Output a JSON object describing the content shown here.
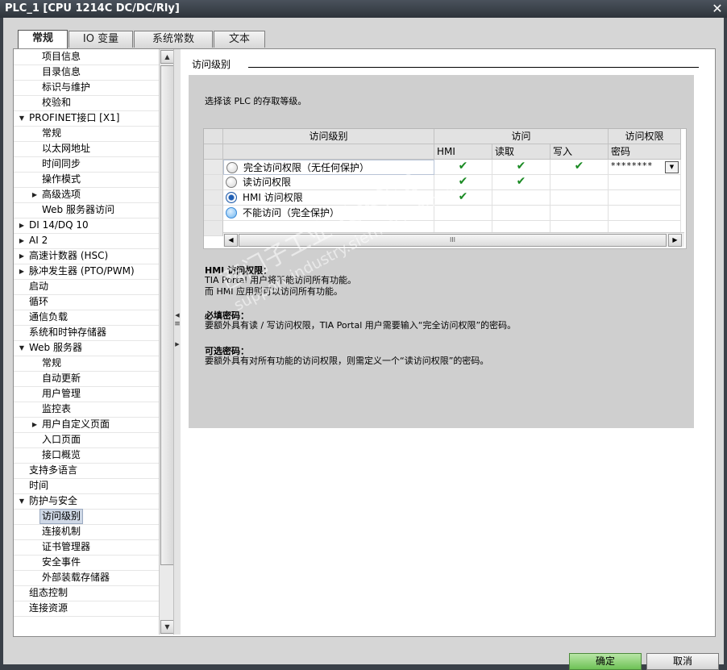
{
  "window": {
    "title": "PLC_1 [CPU 1214C DC/DC/Rly]",
    "close": "✕"
  },
  "tabs": [
    {
      "label": "常规",
      "active": true
    },
    {
      "label": "IO 变量",
      "active": false
    },
    {
      "label": "系统常数",
      "active": false
    },
    {
      "label": "文本",
      "active": false
    }
  ],
  "nav": [
    {
      "label": "项目信息",
      "level": 2,
      "arrow": ""
    },
    {
      "label": "目录信息",
      "level": 2,
      "arrow": ""
    },
    {
      "label": "标识与维护",
      "level": 2,
      "arrow": ""
    },
    {
      "label": "校验和",
      "level": 2,
      "arrow": ""
    },
    {
      "label": "PROFINET接口 [X1]",
      "level": 1,
      "arrow": "▼"
    },
    {
      "label": "常规",
      "level": 2,
      "arrow": ""
    },
    {
      "label": "以太网地址",
      "level": 2,
      "arrow": ""
    },
    {
      "label": "时间同步",
      "level": 2,
      "arrow": ""
    },
    {
      "label": "操作模式",
      "level": 2,
      "arrow": ""
    },
    {
      "label": "高级选项",
      "level": 2,
      "arrow": "▶"
    },
    {
      "label": "Web 服务器访问",
      "level": 2,
      "arrow": ""
    },
    {
      "label": "DI 14/DQ 10",
      "level": 1,
      "arrow": "▶"
    },
    {
      "label": "AI 2",
      "level": 1,
      "arrow": "▶"
    },
    {
      "label": "高速计数器 (HSC)",
      "level": 1,
      "arrow": "▶"
    },
    {
      "label": "脉冲发生器 (PTO/PWM)",
      "level": 1,
      "arrow": "▶"
    },
    {
      "label": "启动",
      "level": 1,
      "arrow": ""
    },
    {
      "label": "循环",
      "level": 1,
      "arrow": ""
    },
    {
      "label": "通信负载",
      "level": 1,
      "arrow": ""
    },
    {
      "label": "系统和时钟存储器",
      "level": 1,
      "arrow": ""
    },
    {
      "label": "Web 服务器",
      "level": 1,
      "arrow": "▼"
    },
    {
      "label": "常规",
      "level": 2,
      "arrow": ""
    },
    {
      "label": "自动更新",
      "level": 2,
      "arrow": ""
    },
    {
      "label": "用户管理",
      "level": 2,
      "arrow": ""
    },
    {
      "label": "监控表",
      "level": 2,
      "arrow": ""
    },
    {
      "label": "用户自定义页面",
      "level": 2,
      "arrow": "▶"
    },
    {
      "label": "入口页面",
      "level": 2,
      "arrow": ""
    },
    {
      "label": "接口概览",
      "level": 2,
      "arrow": ""
    },
    {
      "label": "支持多语言",
      "level": 1,
      "arrow": ""
    },
    {
      "label": "时间",
      "level": 1,
      "arrow": ""
    },
    {
      "label": "防护与安全",
      "level": 1,
      "arrow": "▼"
    },
    {
      "label": "访问级别",
      "level": 2,
      "arrow": "",
      "selected": true
    },
    {
      "label": "连接机制",
      "level": 2,
      "arrow": ""
    },
    {
      "label": "证书管理器",
      "level": 2,
      "arrow": ""
    },
    {
      "label": "安全事件",
      "level": 2,
      "arrow": ""
    },
    {
      "label": "外部装载存储器",
      "level": 2,
      "arrow": ""
    },
    {
      "label": "组态控制",
      "level": 1,
      "arrow": ""
    },
    {
      "label": "连接资源",
      "level": 1,
      "arrow": ""
    }
  ],
  "section": {
    "title": "访问级别",
    "intro": "选择该 PLC 的存取等级。"
  },
  "grid": {
    "header_level": "访问级别",
    "header_access": "访问",
    "header_perm": "访问权限",
    "col_hmi": "HMI",
    "col_read": "读取",
    "col_write": "写入",
    "col_pwd": "密码",
    "rows": [
      {
        "label": "完全访问权限（无任何保护）",
        "radio": "unchecked",
        "hmi": "✔",
        "read": "✔",
        "write": "✔",
        "pwd": "********",
        "dropdown": "▼"
      },
      {
        "label": "读访问权限",
        "radio": "unchecked",
        "hmi": "✔",
        "read": "✔",
        "write": "",
        "pwd": ""
      },
      {
        "label": "HMI 访问权限",
        "radio": "checked",
        "hmi": "✔",
        "read": "",
        "write": "",
        "pwd": ""
      },
      {
        "label": "不能访问（完全保护）",
        "radio": "blue",
        "hmi": "",
        "read": "",
        "write": "",
        "pwd": ""
      }
    ],
    "scroll_thumb": "III"
  },
  "descriptions": {
    "hmi_title": "HMI 访问权限：",
    "hmi_line1": "TIA Portal 用户将不能访问所有功能。",
    "hmi_line2": "而 HMI 应用则可以访问所有功能。",
    "req_title": "必填密码：",
    "req_line1": "要额外具有读 / 写访问权限，TIA Portal 用户需要输入“完全访问权限”的密码。",
    "opt_title": "可选密码：",
    "opt_line1": "要额外具有对所有功能的访问权限，则需定义一个“读访问权限”的密码。"
  },
  "watermark": {
    "line1": "西门子工业 技术论坛",
    "line2": "support.industry.siemens.com/cs"
  },
  "buttons": {
    "ok": "确定",
    "cancel": "取消"
  }
}
